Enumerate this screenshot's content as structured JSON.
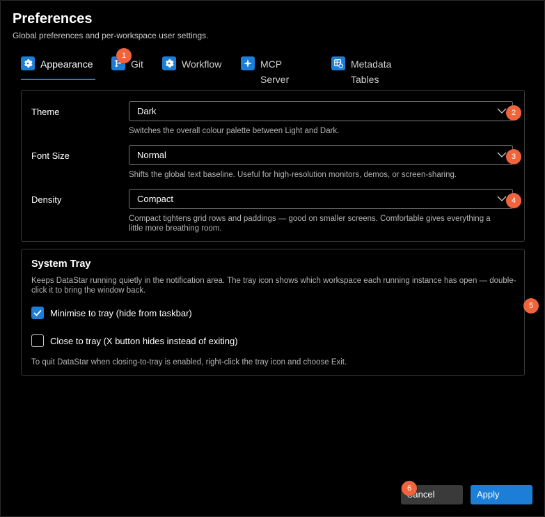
{
  "header": {
    "title": "Preferences",
    "subtitle": "Global preferences and per-workspace user settings."
  },
  "tabs": [
    {
      "label": "Appearance",
      "icon": "gear-icon",
      "active": true
    },
    {
      "label": "Git",
      "icon": "git-icon",
      "active": false
    },
    {
      "label": "Workflow",
      "icon": "gear-icon",
      "active": false
    },
    {
      "label": "MCP Server",
      "icon": "sparkle-icon",
      "active": false
    },
    {
      "label": "Metadata Tables",
      "icon": "table-settings-icon",
      "active": false
    }
  ],
  "appearance": {
    "theme": {
      "label": "Theme",
      "value": "Dark",
      "help": "Switches the overall colour palette between Light and Dark."
    },
    "font_size": {
      "label": "Font Size",
      "value": "Normal",
      "help": "Shifts the global text baseline. Useful for high-resolution monitors, demos, or screen-sharing."
    },
    "density": {
      "label": "Density",
      "value": "Compact",
      "help": "Compact tightens grid rows and paddings — good on smaller screens. Comfortable gives everything a little more breathing room."
    }
  },
  "system_tray": {
    "title": "System Tray",
    "description": "Keeps DataStar running quietly in the notification area. The tray icon shows which workspace each running instance has open — double-click it to bring the window back.",
    "minimise_label": "Minimise to tray (hide from taskbar)",
    "minimise_checked": true,
    "close_label": "Close to tray (X button hides instead of exiting)",
    "close_checked": false,
    "note": "To quit DataStar when closing-to-tray is enabled, right-click the tray icon and choose Exit."
  },
  "footer": {
    "cancel_label": "Cancel",
    "apply_label": "Apply"
  },
  "markers": [
    "1",
    "2",
    "3",
    "4",
    "5",
    "6"
  ],
  "colors": {
    "accent": "#1c7ed6",
    "marker": "#f0643c",
    "background": "#000000"
  }
}
